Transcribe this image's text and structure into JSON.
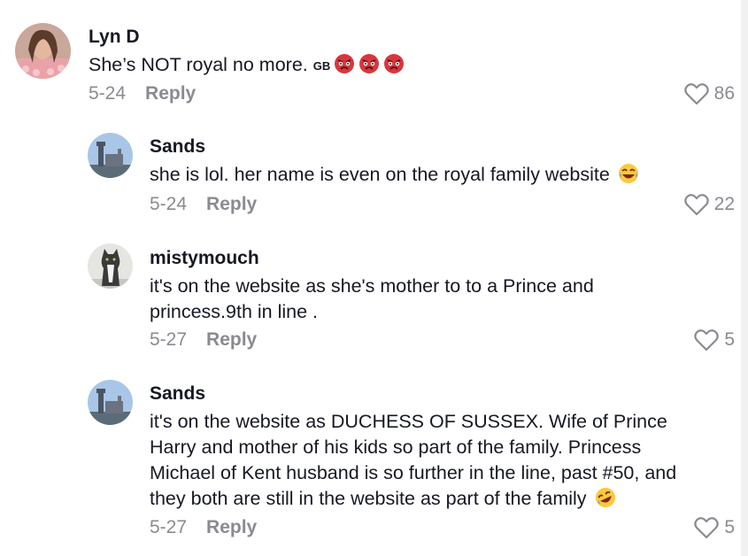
{
  "comments": [
    {
      "username": "Lyn D",
      "text": "She’s NOT royal no more.",
      "flag": "GB",
      "date": "5-24",
      "reply_label": "Reply",
      "likes": "86"
    },
    {
      "username": "Sands",
      "text": "she is lol. her name is even on the royal family website",
      "date": "5-24",
      "reply_label": "Reply",
      "likes": "22"
    },
    {
      "username": "mistymouch",
      "text_lines": [
        "it's on the website as she's mother to to a Prince and",
        "princess.9th in line ."
      ],
      "date": "5-27",
      "reply_label": "Reply",
      "likes": "5"
    },
    {
      "username": "Sands",
      "text_lines": [
        "it's on the website as DUCHESS OF SUSSEX. Wife of Prince",
        "Harry and mother of his kids so part of the family. Princess",
        "Michael of Kent husband is so further in the line, past #50, and",
        "they both are still in the website as part of the family"
      ],
      "date": "5-27",
      "reply_label": "Reply",
      "likes": "5"
    }
  ],
  "icons": {
    "angry": "angry-face-icon",
    "laugh": "laughing-face-icon",
    "rofl": "rolling-laughing-face-icon",
    "like": "heart-outline-icon"
  },
  "colors": {
    "text": "#161823",
    "muted": "#8a8b91",
    "emoji_red": "#d9363e"
  }
}
